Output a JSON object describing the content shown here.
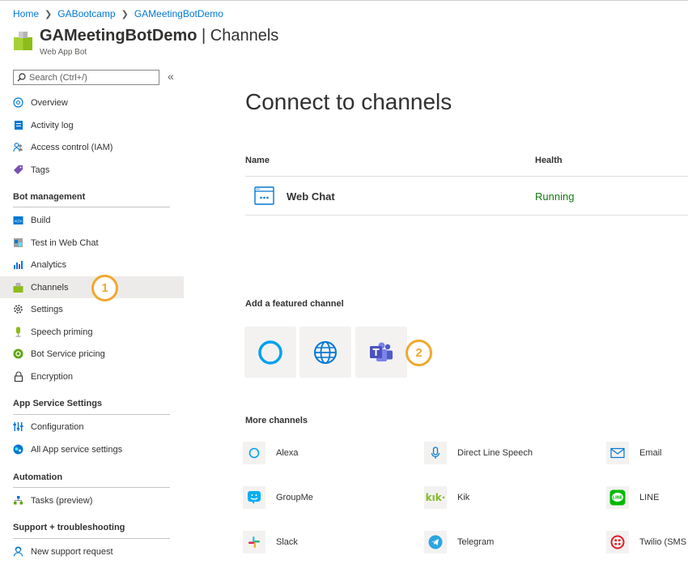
{
  "breadcrumb": {
    "items": [
      "Home",
      "GABootcamp",
      "GAMeetingBotDemo"
    ]
  },
  "header": {
    "name": "GAMeetingBotDemo",
    "divider": "|",
    "page": "Channels",
    "subtitle": "Web App Bot"
  },
  "search": {
    "placeholder": "Search (Ctrl+/)",
    "collapse_glyph": "«"
  },
  "sidebar": {
    "top_items": [
      "Overview",
      "Activity log",
      "Access control (IAM)",
      "Tags"
    ],
    "sections": {
      "bot_management": "Bot management",
      "app_service_settings": "App Service Settings",
      "automation": "Automation",
      "support": "Support + troubleshooting"
    },
    "bot_items": [
      "Build",
      "Test in Web Chat",
      "Analytics",
      "Channels",
      "Settings",
      "Speech priming",
      "Bot Service pricing",
      "Encryption"
    ],
    "app_items": [
      "Configuration",
      "All App service settings"
    ],
    "automation_items": [
      "Tasks (preview)"
    ],
    "support_items": [
      "New support request"
    ],
    "selected": "Channels"
  },
  "badges": {
    "one": "1",
    "two": "2"
  },
  "main": {
    "title": "Connect to channels",
    "columns": {
      "name": "Name",
      "health": "Health"
    },
    "rows": [
      {
        "name": "Web Chat",
        "health": "Running"
      }
    ],
    "featured_heading": "Add a featured channel",
    "featured_icons": [
      "cortana-icon",
      "globe-icon",
      "teams-icon"
    ],
    "more_heading": "More channels",
    "more_channels": [
      "Alexa",
      "Direct Line Speech",
      "Email",
      "GroupMe",
      "Kik",
      "LINE",
      "Slack",
      "Telegram",
      "Twilio (SMS"
    ]
  },
  "colors": {
    "link": "#0078d4",
    "running": "#107c10",
    "badge": "#f0a830",
    "selected_bg": "#edebe9"
  }
}
